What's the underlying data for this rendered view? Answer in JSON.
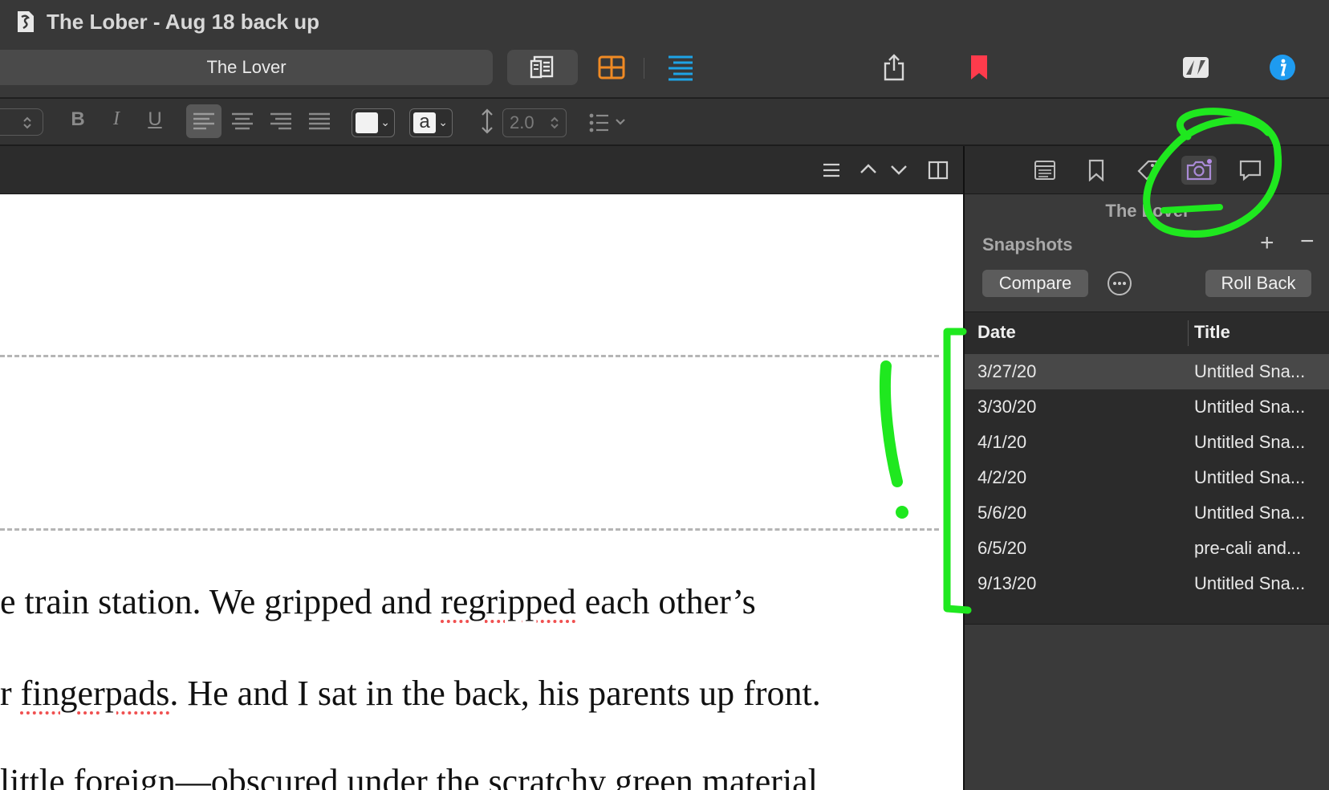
{
  "window": {
    "title": "The Lober - Aug 18 back up"
  },
  "toolbar": {
    "binder_title": "The Lover",
    "icons": [
      "view-mode-icon",
      "corkboard-icon",
      "outline-icon",
      "share-icon",
      "bookmark-icon",
      "compose-icon",
      "info-icon"
    ],
    "colors": {
      "corkboard": "#f08a24",
      "outline": "#1ea3e6",
      "bookmark": "#ff3b4c",
      "info": "#1e9bf0"
    }
  },
  "format": {
    "bold": "B",
    "italic": "I",
    "underline": "U",
    "highlight_label": "a",
    "line_spacing": "2.0"
  },
  "editor": {
    "lines": [
      {
        "pre": "e train station. We gripped and ",
        "miss": "regripped",
        "post": " each other’s"
      },
      {
        "pre": "r ",
        "miss": "fingerpads",
        "post": ". He and I sat in the back, his parents up front."
      },
      {
        "pre": "little foreign—obscured under the scratchy green material",
        "miss": "",
        "post": ""
      }
    ]
  },
  "inspector": {
    "document_title": "The Lover",
    "section_label": "Snapshots",
    "plus": "+",
    "minus": "−",
    "compare_label": "Compare",
    "rollback_label": "Roll Back",
    "columns": {
      "date": "Date",
      "title": "Title"
    },
    "rows": [
      {
        "date": "3/27/20",
        "title": "Untitled Sna..."
      },
      {
        "date": "3/30/20",
        "title": "Untitled Sna..."
      },
      {
        "date": "4/1/20",
        "title": "Untitled Sna..."
      },
      {
        "date": "4/2/20",
        "title": "Untitled Sna..."
      },
      {
        "date": "5/6/20",
        "title": "Untitled Sna..."
      },
      {
        "date": "6/5/20",
        "title": "pre-cali and..."
      },
      {
        "date": "9/13/20",
        "title": "Untitled Sna..."
      }
    ],
    "selected_row": 0
  },
  "annotation": {
    "color": "#1fe81f"
  }
}
